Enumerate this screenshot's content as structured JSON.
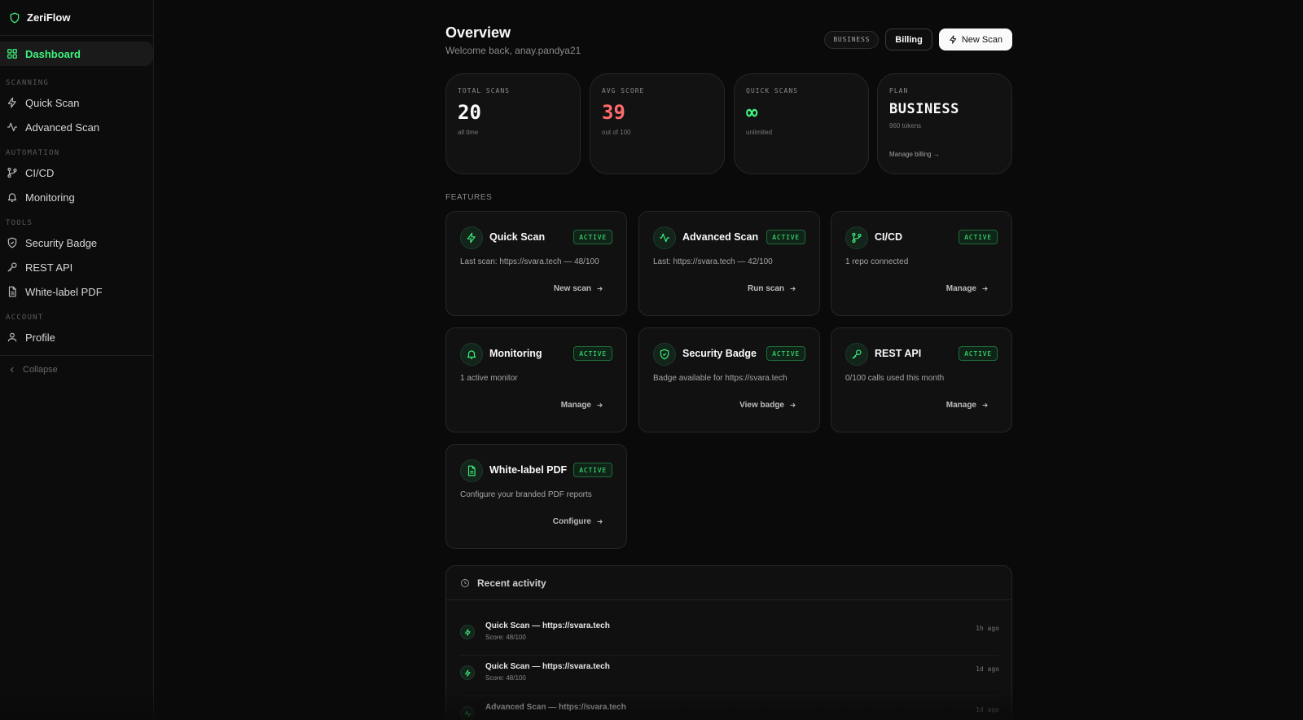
{
  "app": {
    "name": "ZeriFlow"
  },
  "sidebar": {
    "dashboard": "Dashboard",
    "sections": {
      "scanning": "SCANNING",
      "automation": "AUTOMATION",
      "tools": "TOOLS",
      "account": "ACCOUNT"
    },
    "items": {
      "quick_scan": "Quick Scan",
      "advanced_scan": "Advanced Scan",
      "cicd": "CI/CD",
      "monitoring": "Monitoring",
      "security_badge": "Security Badge",
      "rest_api": "REST API",
      "white_label_pdf": "White-label PDF",
      "profile": "Profile"
    },
    "collapse": "Collapse"
  },
  "header": {
    "title": "Overview",
    "subtitle": "Welcome back, anay.pandya21",
    "plan_pill": "BUSINESS",
    "billing": "Billing",
    "new_scan": "New Scan"
  },
  "stats": {
    "total_scans": {
      "label": "TOTAL SCANS",
      "value": "20",
      "sub": "all time"
    },
    "avg_score": {
      "label": "AVG SCORE",
      "value": "39",
      "sub": "out of 100"
    },
    "quick_scans": {
      "label": "QUICK SCANS",
      "value": "∞",
      "sub": "unlimited"
    },
    "plan": {
      "label": "PLAN",
      "value": "BUSINESS",
      "sub": "960 tokens",
      "link": "Manage billing →"
    }
  },
  "features": {
    "label": "FEATURES",
    "status": "ACTIVE",
    "cards": {
      "quick_scan": {
        "name": "Quick Scan",
        "desc": "Last scan: https://svara.tech — 48/100",
        "action": "New scan"
      },
      "advanced_scan": {
        "name": "Advanced Scan",
        "desc": "Last: https://svara.tech — 42/100",
        "action": "Run scan"
      },
      "cicd": {
        "name": "CI/CD",
        "desc": "1 repo connected",
        "action": "Manage"
      },
      "monitoring": {
        "name": "Monitoring",
        "desc": "1 active monitor",
        "action": "Manage"
      },
      "security_badge": {
        "name": "Security Badge",
        "desc": "Badge available for https://svara.tech",
        "action": "View badge"
      },
      "rest_api": {
        "name": "REST API",
        "desc": "0/100 calls used this month",
        "action": "Manage"
      },
      "white_label_pdf": {
        "name": "White-label PDF",
        "desc": "Configure your branded PDF reports",
        "action": "Configure"
      }
    }
  },
  "activity": {
    "title": "Recent activity",
    "rows": [
      {
        "title": "Quick Scan — https://svara.tech",
        "sub": "Score: 48/100",
        "time": "1h ago"
      },
      {
        "title": "Quick Scan — https://svara.tech",
        "sub": "Score: 48/100",
        "time": "1d ago"
      },
      {
        "title": "Advanced Scan — https://svara.tech",
        "sub": "",
        "time": "1d ago"
      }
    ]
  },
  "colors": {
    "accent": "#3ef27e",
    "danger": "#ff6b6b",
    "background": "#0a0a0a"
  }
}
